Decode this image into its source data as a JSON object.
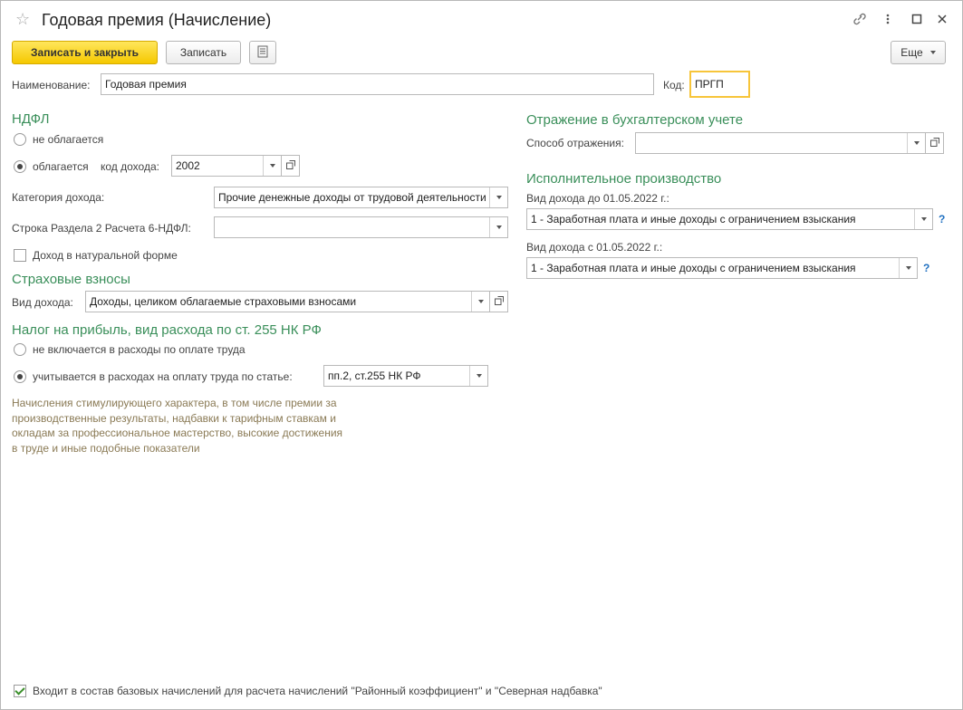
{
  "window": {
    "title": "Годовая премия (Начисление)"
  },
  "toolbar": {
    "save_close": "Записать и закрыть",
    "save": "Записать",
    "more": "Еще"
  },
  "header": {
    "name_label": "Наименование:",
    "name_value": "Годовая премия",
    "code_label": "Код:",
    "code_value": "ПРГП"
  },
  "ndfl": {
    "title": "НДФЛ",
    "not_taxed": "не облагается",
    "taxed": "облагается",
    "income_code_label": "код дохода:",
    "income_code_value": "2002",
    "category_label": "Категория дохода:",
    "category_value": "Прочие денежные доходы от трудовой деятельности",
    "row_label": "Строка Раздела 2 Расчета 6-НДФЛ:",
    "row_value": "",
    "natural_label": "Доход в натуральной форме",
    "natural_checked": false
  },
  "insurance": {
    "title": "Страховые взносы",
    "income_type_label": "Вид дохода:",
    "income_type_value": "Доходы, целиком облагаемые страховыми взносами"
  },
  "profit_tax": {
    "title": "Налог на прибыль, вид расхода по ст. 255 НК РФ",
    "not_included": "не включается в расходы по оплате труда",
    "included": "учитывается в расходах на оплату труда по статье:",
    "article_value": "пп.2, ст.255 НК РФ",
    "note": "Начисления стимулирующего характера, в том числе премии за\nпроизводственные результаты, надбавки к тарифным ставкам и\nокладам за профессиональное мастерство, высокие достижения\nв труде и иные подобные показатели"
  },
  "accounting": {
    "title": "Отражение в бухгалтерском учете",
    "method_label": "Способ отражения:",
    "method_value": ""
  },
  "enforcement": {
    "title": "Исполнительное производство",
    "before_label": "Вид дохода до 01.05.2022 г.:",
    "before_value": "1 - Заработная плата и иные доходы с ограничением взыскания",
    "after_label": "Вид дохода с 01.05.2022 г.:",
    "after_value": "1 - Заработная плата и иные доходы с ограничением взыскания",
    "help": "?"
  },
  "footer": {
    "base_label": "Входит в состав базовых начислений для расчета начислений \"Районный коэффициент\" и \"Северная надбавка\"",
    "base_checked": true
  },
  "colors": {
    "section": "#3a8f5a",
    "primary_button": "#f5c800",
    "focus_border": "#f7c53a",
    "help": "#1e6fc0",
    "note": "#8a7a55"
  },
  "icons": [
    "star-icon",
    "link-icon",
    "more-vertical-icon",
    "maximize-icon",
    "close-icon",
    "list-icon",
    "chevron-down-icon",
    "open-icon"
  ]
}
